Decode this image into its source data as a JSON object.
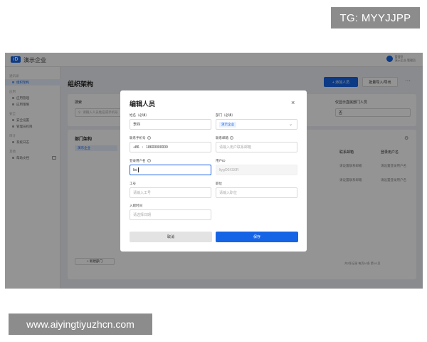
{
  "watermark": {
    "top": "TG: MYYJJPP",
    "bottom": "www.aiyingtiyuzhcn.com"
  },
  "app": {
    "logo": "iD",
    "org_name": "演示企业",
    "user_name": "管理员",
    "user_sub": "演示企业-管理员"
  },
  "sidebar": {
    "items": [
      {
        "label": "通讯录",
        "type": "group"
      },
      {
        "label": "组织架构",
        "type": "link",
        "active": true
      },
      {
        "label": "应用",
        "type": "group"
      },
      {
        "label": "应用管理",
        "type": "link"
      },
      {
        "label": "应用策略",
        "type": "link"
      },
      {
        "label": "安全",
        "type": "group"
      },
      {
        "label": "安全设置",
        "type": "link"
      },
      {
        "label": "管理员权限",
        "type": "link"
      },
      {
        "label": "审计",
        "type": "group"
      },
      {
        "label": "系统日志",
        "type": "link"
      },
      {
        "label": "其他",
        "type": "group"
      },
      {
        "label": "帮助文档",
        "type": "link"
      }
    ]
  },
  "main": {
    "page_title": "组织架构",
    "add_button": "+ 添加人员",
    "import_button": "批量导入/导出",
    "more": "···",
    "filter": {
      "search_label": "搜索",
      "search_placeholder": "请输入人员姓名或手机号",
      "right_label": "仅显示直属部门人员",
      "right_value": "否"
    },
    "dept": {
      "title": "部门架构",
      "root_node": "演示企业",
      "col_account": "联系邮箱",
      "col_username": "登录用户名",
      "rows": [
        {
          "email": "请设置联系邮箱",
          "username": "请设置登录用户名"
        },
        {
          "email": "请设置联系邮箱",
          "username": "请设置登录用户名"
        }
      ],
      "pager": "共2条记录 每页10条 第1/1页",
      "new_dept_button": "+ 新建部门"
    }
  },
  "modal": {
    "title": "编辑人员",
    "close": "×",
    "fields": {
      "name": {
        "label": "姓名（必填）",
        "value": "李四"
      },
      "department": {
        "label": "部门（必填）",
        "value": "演示企业"
      },
      "phone": {
        "label": "联系手机号",
        "code": "+86",
        "value": "18600000000"
      },
      "email": {
        "label": "联系邮箱",
        "placeholder": "请输入用户联系邮箱"
      },
      "login_username": {
        "label": "登录用户名",
        "value": "lisi"
      },
      "user_id": {
        "label": "用户ID",
        "value": "ltygO0XS0R"
      },
      "employee_no": {
        "label": "工号",
        "placeholder": "请输入工号"
      },
      "position": {
        "label": "职位",
        "placeholder": "请输入职位"
      },
      "join_date": {
        "label": "入职时间",
        "placeholder": "请选择日期"
      }
    },
    "cancel_button": "取消",
    "save_button": "保存"
  },
  "colors": {
    "accent": "#1664e6",
    "overlay": "rgba(0,0,0,0.42)"
  }
}
